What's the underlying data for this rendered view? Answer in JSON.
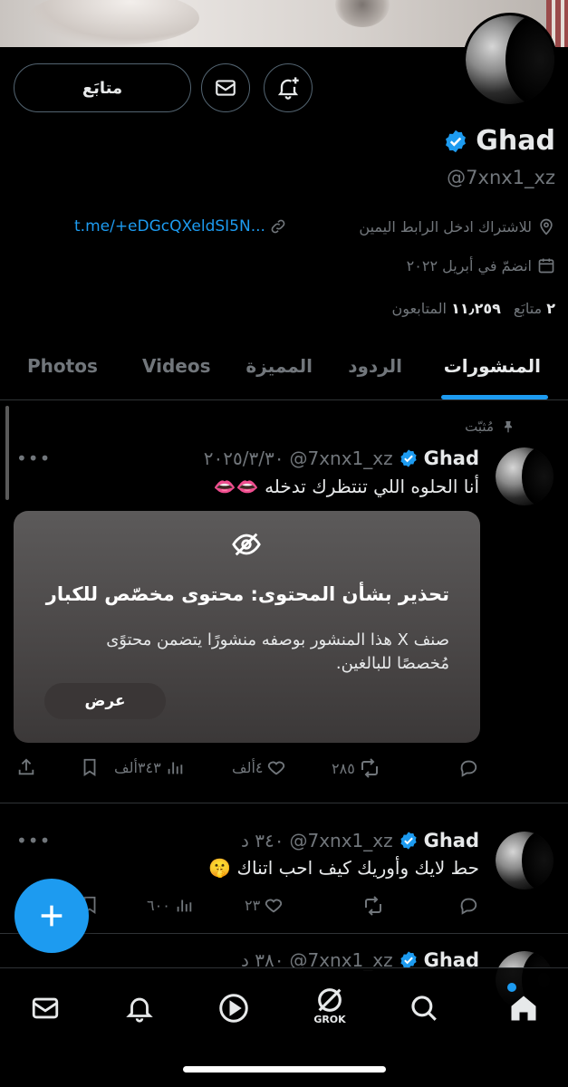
{
  "profile": {
    "follow_label": "متابَع",
    "name": "Ghad",
    "handle": "@7xnx1_xz",
    "bio_line": "للاشتراك ادخل الرابط اليمين",
    "link": "t.me/+eDGcQXeldSI5N...",
    "joined": "انضمّ في أبريل ٢٠٢٢",
    "following_count": "٢",
    "following_label": "متابَع",
    "followers_count": "١١٫٢٥٩",
    "followers_label": "المتابعون"
  },
  "tabs": [
    {
      "label": "المنشورات",
      "active": true
    },
    {
      "label": "الردود"
    },
    {
      "label": "المميزة"
    },
    {
      "label": "Videos"
    },
    {
      "label": "Photos"
    }
  ],
  "pinned_label": "مُثبّت",
  "tweets": [
    {
      "name": "Ghad",
      "handle": "@7xnx1_xz",
      "time": "٢٠٢٥/٣/٣٠",
      "text": "أنا الحلوه اللي تنتظرك تدخله 👄👄",
      "warning": {
        "title": "تحذير بشأن المحتوى: محتوى مخصّص للكبار",
        "body": "صنف X هذا المنشور بوصفه منشورًا يتضمن محتوًى مُخصصًا للبالغين.",
        "button": "عرض"
      },
      "replies": "",
      "retweets": "٢٨٥",
      "likes": "٤ألف",
      "views": "٣٤٣ألف"
    },
    {
      "name": "Ghad",
      "handle": "@7xnx1_xz",
      "time": "٣٤٠ د",
      "text": "حط لايك وأوريك كيف احب اتناك 🤫",
      "replies": "",
      "retweets": "",
      "likes": "٢٣",
      "views": "٦٠٠"
    },
    {
      "name": "Ghad",
      "handle": "@7xnx1_xz",
      "time": "٣٨٠ د"
    }
  ],
  "nav": {
    "grok_label": "GROK",
    "icons": [
      "mail-icon",
      "bell-icon",
      "play-icon",
      "grok-icon",
      "search-icon",
      "home-icon"
    ]
  },
  "colors": {
    "accent": "#1d9bf0",
    "background": "#000000",
    "muted": "#71767b"
  }
}
